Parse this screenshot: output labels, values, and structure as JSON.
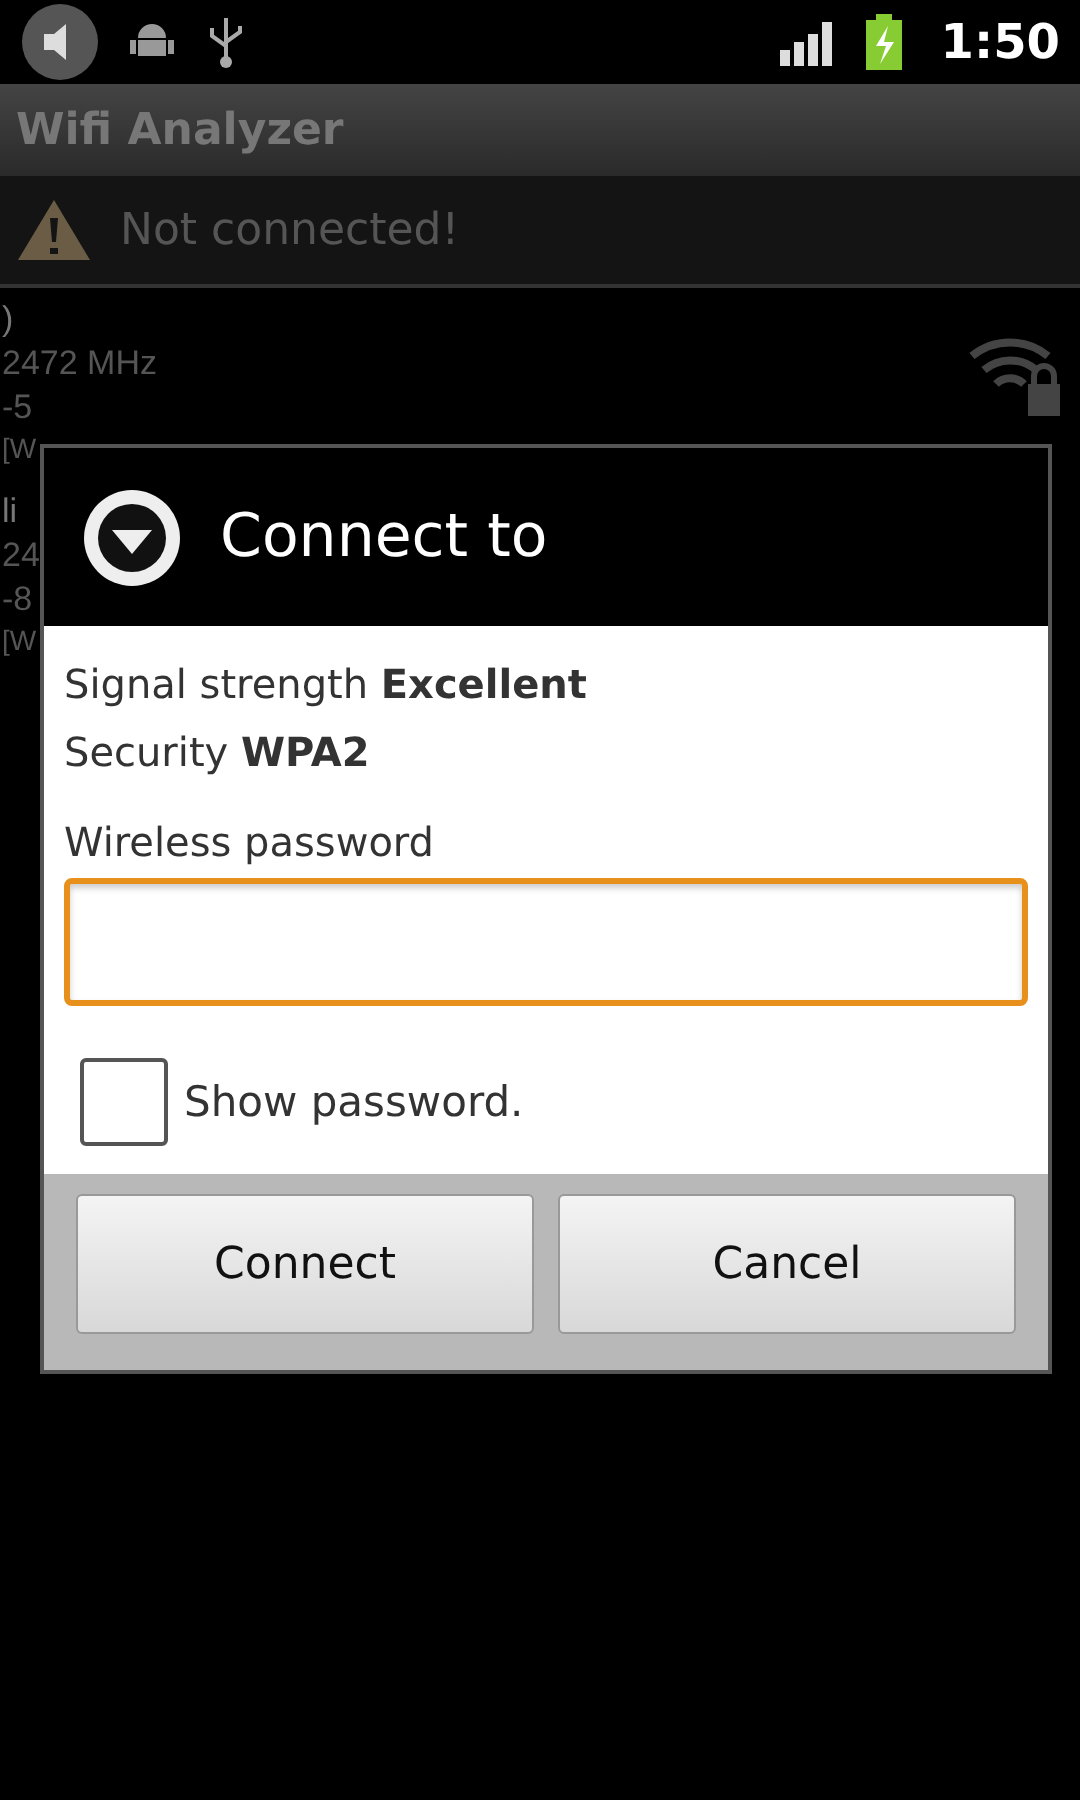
{
  "status_bar": {
    "time": "1:50"
  },
  "app_bar": {
    "title": "Wifi Analyzer"
  },
  "notice": {
    "text": "Not connected!"
  },
  "networks": [
    {
      "name_tail": ")",
      "lines": [
        "2472 MHz",
        "-5",
        "[W"
      ],
      "locked": true
    },
    {
      "name_tail": "li",
      "lines": [
        "24",
        "-8",
        "[W"
      ]
    }
  ],
  "dialog": {
    "title": "Connect to",
    "details": [
      {
        "label": "Signal strength",
        "value": "Excellent"
      },
      {
        "label": "Security",
        "value": "WPA2"
      }
    ],
    "password_label": "Wireless password",
    "password": {
      "focused": true
    },
    "show_password": {
      "label": "Show password.",
      "checked": false
    },
    "buttons": [
      "Connect",
      "Cancel"
    ]
  }
}
